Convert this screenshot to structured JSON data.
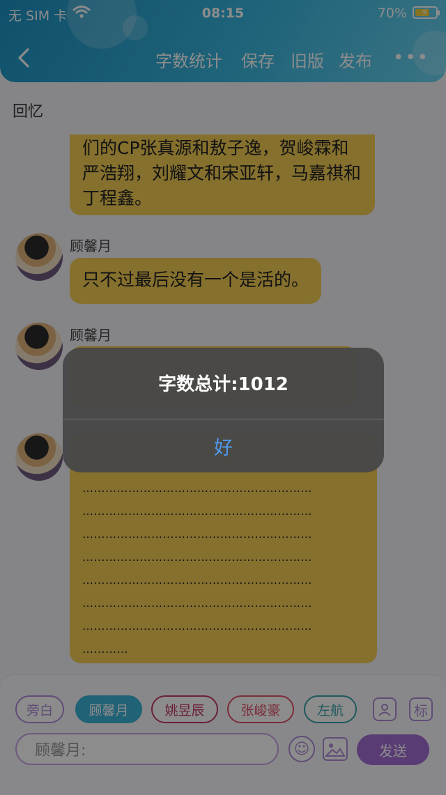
{
  "status_bar": {
    "carrier": "无 SIM 卡",
    "time": "08:15",
    "battery": "70%",
    "battery_level": 0.7
  },
  "header": {
    "back_icon": "chevron-left-icon",
    "actions": [
      "字数统计",
      "保存",
      "旧版",
      "发布"
    ],
    "more_label": "•••"
  },
  "story_title": "回忆",
  "messages": [
    {
      "text": "们的CP张真源和敖子逸，贺峻霖和严浩翔，刘耀文和宋亚轩，马嘉祺和丁程鑫。"
    },
    {
      "sender": "顾馨月",
      "text": "只不过最后没有一个是活的。"
    },
    {
      "sender": "顾馨月"
    },
    {
      "dots": [
        "……………………………………………………",
        "……………………………………………………",
        "……………………………………………………",
        "……………………………………………………",
        "……………………………………………………",
        "……………………………………………………",
        "……………………………………………………",
        "…………"
      ]
    }
  ],
  "characters": [
    {
      "name": "旁白",
      "color": "#b08ad8"
    },
    {
      "name": "顾馨月",
      "color": "#3bb3d8"
    },
    {
      "name": "姚昱辰",
      "color": "#c0396b"
    },
    {
      "name": "张峻豪",
      "color": "#e0506a"
    },
    {
      "name": "左航",
      "color": "#3aa0a8"
    }
  ],
  "tools": {
    "add_role_icon": "person-card-icon",
    "tag_label": "标"
  },
  "input": {
    "placeholder": "顾馨月:"
  },
  "send_label": "发送",
  "alert": {
    "title": "字数总计:1012",
    "ok_label": "好"
  },
  "colors": {
    "header_start": "#1e92c4",
    "bubble": "#f3cc55",
    "accent_purple": "#a46dd6",
    "alert_button": "#4e9bf0"
  }
}
